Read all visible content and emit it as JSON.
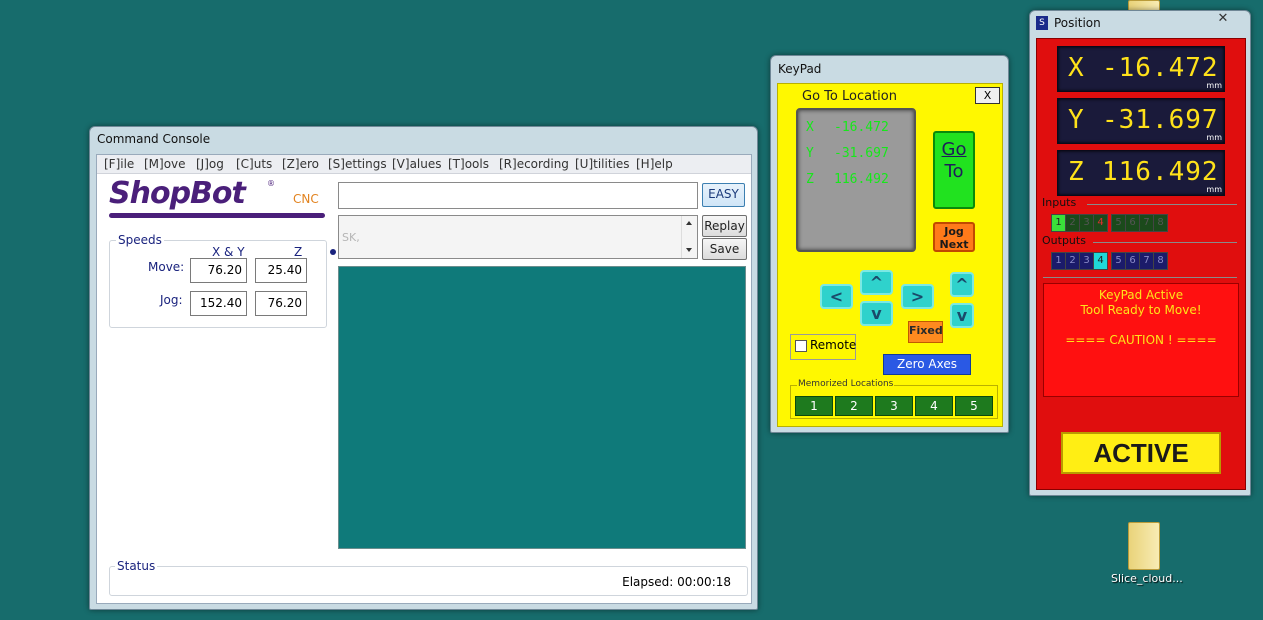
{
  "desktop": {
    "icon_label": "Slice_cloud..."
  },
  "console": {
    "title": "Command Console",
    "menu": [
      "[F]ile",
      "[M]ove",
      "[J]og",
      "[C]uts",
      "[Z]ero",
      "[S]ettings",
      "[V]alues",
      "[T]ools",
      "[R]ecording",
      "[U]tilities",
      "[H]elp"
    ],
    "logo_text": "ShopBot",
    "logo_reg": "®",
    "logo_cnc": "CNC",
    "speeds_label": "Speeds",
    "col_xy": "X & Y",
    "col_z": "Z",
    "move_label": "Move:",
    "jog_label": "Jog:",
    "move_xy": "76.20",
    "move_z": "25.40",
    "jog_xy": "152.40",
    "jog_z": "76.20",
    "command_value": "",
    "easy_label": "EASY",
    "history_text": "SK,",
    "replay_label": "Replay",
    "save_label": "Save",
    "status_label": "Status",
    "elapsed": "Elapsed: 00:00:18"
  },
  "keypad": {
    "title": "KeyPad",
    "goto_title": "Go To Location",
    "close_label": "X",
    "lcd": {
      "x_label": "X",
      "x_value": "-16.472",
      "y_label": "Y",
      "y_value": "-31.697",
      "z_label": "Z",
      "z_value": "116.492"
    },
    "goto_line1": "Go",
    "goto_line2": "To",
    "jog_line1": "Jog",
    "jog_line2": "Next",
    "left_arrow": "<",
    "right_arrow": ">",
    "up_arrow": "^",
    "down_arrow": "v",
    "fixed_label": "Fixed",
    "remote_label": "Remote",
    "zero_axes_label": "Zero Axes",
    "memorized_label": "Memorized Locations",
    "memorized": [
      "1",
      "2",
      "3",
      "4",
      "5"
    ]
  },
  "position": {
    "title": "Position",
    "close_label": "✕",
    "x_label": "X",
    "x_value": "-16.472",
    "y_label": "Y",
    "y_value": "-31.697",
    "z_label": "Z",
    "z_value": "116.492",
    "unit": "mm",
    "inputs_label": "Inputs",
    "outputs_label": "Outputs",
    "inputs": [
      "1",
      "2",
      "3",
      "4",
      "5",
      "6",
      "7",
      "8"
    ],
    "outputs": [
      "1",
      "2",
      "3",
      "4",
      "5",
      "6",
      "7",
      "8"
    ],
    "input_active": 1,
    "output_active": 4,
    "msg_line1": "KeyPad Active",
    "msg_line2": "Tool Ready to Move!",
    "msg_line3": "==== CAUTION ! ====",
    "active_label": "ACTIVE"
  },
  "colors": {
    "desktop": "#176c6c",
    "keypad_bg": "#fff800",
    "position_bg": "#e00e0e",
    "dro_digits": "#ffe21a",
    "lcd_digits": "#16e81a",
    "logo": "#4a1f7a"
  }
}
